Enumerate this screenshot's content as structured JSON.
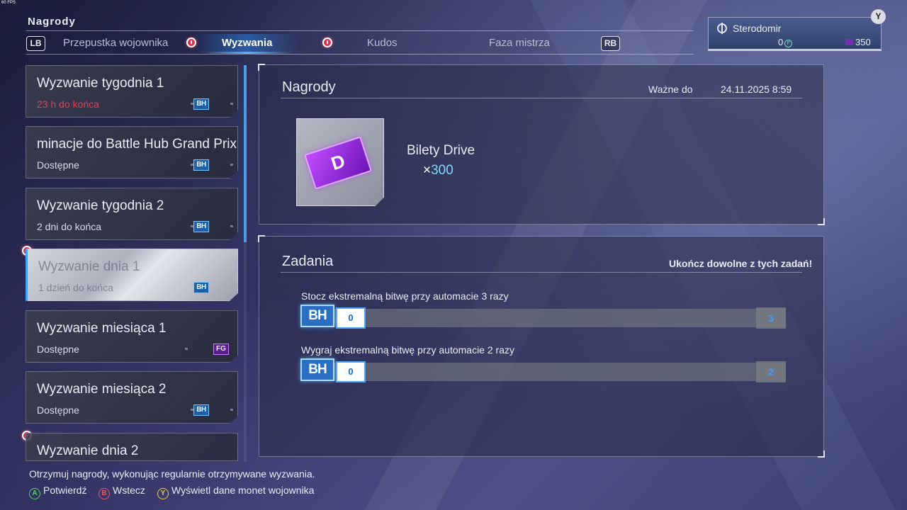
{
  "overlay": {
    "fps": "60 FPS"
  },
  "header": {
    "title": "Nagrody",
    "lb": "LB",
    "rb": "RB",
    "tabs": [
      "Przepustka wojownika",
      "Wyzwania",
      "Kudos",
      "Faza mistrza"
    ],
    "active_tab": "Wyzwania"
  },
  "player": {
    "name": "Sterodomir",
    "fight_money": "0",
    "fight_money_icon": "F",
    "drive_money": "350",
    "y_button": "Y"
  },
  "challenges": [
    {
      "title": "Wyzwanie tygodnia 1",
      "subtitle": "23 h do końca",
      "badge": "BH"
    },
    {
      "title": "minacje do Battle Hub Grand Prix",
      "subtitle": "Dostępne",
      "badge": "BH"
    },
    {
      "title": "Wyzwanie tygodnia 2",
      "subtitle": "2 dni do końca",
      "badge": "BH"
    },
    {
      "title": "Wyzwanie dnia 1",
      "subtitle": "1 dzień do końca",
      "badge": "BH"
    },
    {
      "title": "Wyzwanie miesiąca 1",
      "subtitle": "Dostępne",
      "badge": "FG"
    },
    {
      "title": "Wyzwanie miesiąca 2",
      "subtitle": "Dostępne",
      "badge": "BH"
    },
    {
      "title": "Wyzwanie dnia 2",
      "subtitle": "",
      "badge": ""
    }
  ],
  "rewards": {
    "title": "Nagrody",
    "valid_label": "Ważne do",
    "valid_date": "24.11.2025 8:59",
    "item_name": "Bilety Drive",
    "item_qty_prefix": "×",
    "item_qty": "300",
    "ticket_letter": "D"
  },
  "tasks": {
    "title": "Zadania",
    "hint": "Ukończ dowolne z tych zadań!",
    "items": [
      {
        "label": "Stocz ekstremalną bitwę przy automacie 3 razy",
        "badge": "BH",
        "current": "0",
        "target": "3",
        "progress": 0
      },
      {
        "label": "Wygraj ekstremalną bitwę przy automacie 2 razy",
        "badge": "BH",
        "current": "0",
        "target": "2",
        "progress": 0
      }
    ]
  },
  "footer": {
    "description": "Otrzymuj nagrody, wykonując regularnie otrzymywane wyzwania.",
    "confirm_button": "A",
    "confirm_label": "Potwierdź",
    "back_button": "B",
    "back_label": "Wstecz",
    "info_button": "Y",
    "info_label": "Wyświetl dane monet wojownika"
  },
  "colors": {
    "accent": "#3aa3ff",
    "alert": "#e4405a",
    "ticket": "#8a2be2"
  }
}
